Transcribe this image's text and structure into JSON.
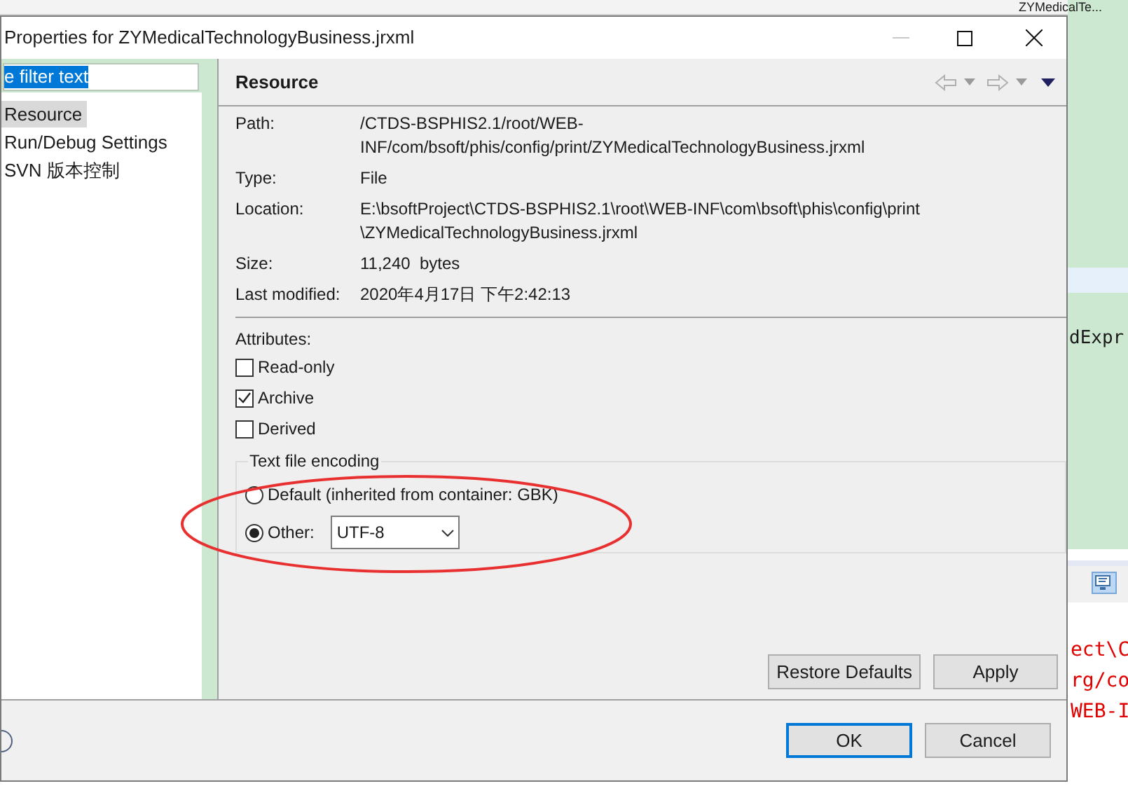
{
  "window": {
    "title": "Properties for ZYMedicalTechnologyBusiness.jrxml",
    "minimize_disabled": true
  },
  "filter": {
    "value": "e filter text",
    "selected": true
  },
  "nav_items": [
    {
      "label": "Resource",
      "selected": true
    },
    {
      "label": "Run/Debug Settings",
      "selected": false
    },
    {
      "label": "SVN 版本控制",
      "selected": false
    }
  ],
  "page": {
    "title": "Resource"
  },
  "properties": [
    {
      "label": "Path:",
      "lines": [
        "/CTDS-BSPHIS2.1/root/WEB-",
        "INF/com/bsoft/phis/config/print/ZYMedicalTechnologyBusiness.jrxml"
      ]
    },
    {
      "label": "Type:",
      "lines": [
        "File"
      ]
    },
    {
      "label": "Location:",
      "lines": [
        "E:\\bsoftProject\\CTDS-BSPHIS2.1\\root\\WEB-INF\\com\\bsoft\\phis\\config\\print",
        "\\ZYMedicalTechnologyBusiness.jrxml"
      ]
    },
    {
      "label": "Size:",
      "lines": [
        "11,240  bytes"
      ]
    },
    {
      "label": "Last modified:",
      "lines": [
        "2020年4月17日 下午2:42:13"
      ]
    }
  ],
  "attributes": {
    "label": "Attributes:",
    "items": [
      {
        "label": "Read-only",
        "checked": false
      },
      {
        "label": "Archive",
        "checked": true
      },
      {
        "label": "Derived",
        "checked": false
      }
    ]
  },
  "encoding": {
    "label": "Text file encoding",
    "options": [
      {
        "kind": "plain",
        "label": "Default (inherited from container: GBK)",
        "selected": false
      },
      {
        "kind": "select",
        "label": "Other:",
        "selected": true,
        "value": "UTF-8"
      }
    ]
  },
  "page_buttons": [
    "Restore Defaults",
    "Apply"
  ],
  "dialog_buttons": [
    {
      "label": "OK",
      "default": true
    },
    {
      "label": "Cancel",
      "default": false
    }
  ],
  "background": {
    "tab": "ZYMedicalTe...",
    "editor_text": "dExpr",
    "console_lines": [
      "ect\\C",
      "rg/co",
      "WEB-I"
    ]
  }
}
